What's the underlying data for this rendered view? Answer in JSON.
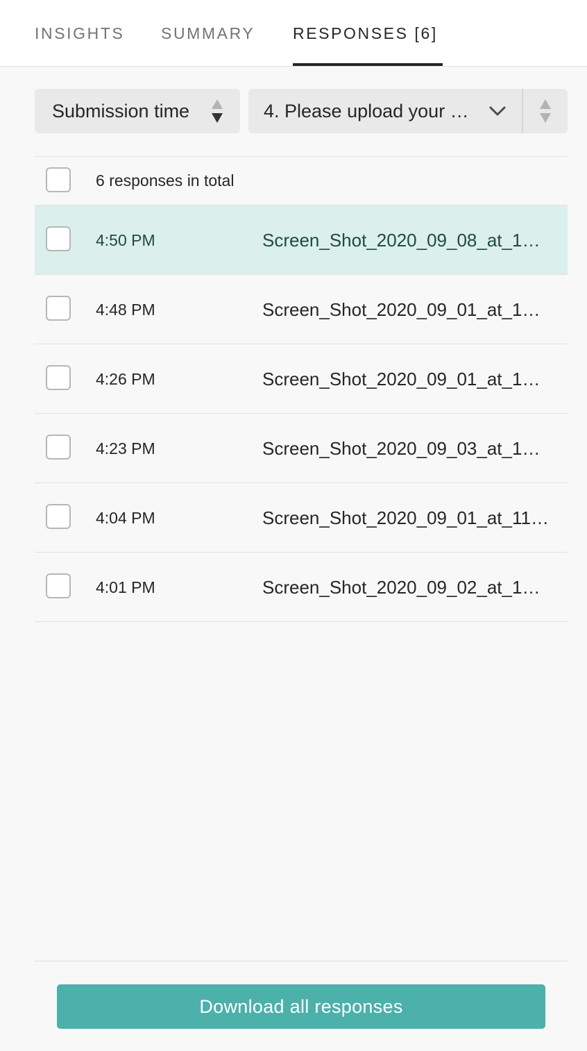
{
  "tabs": [
    {
      "label": "INSIGHTS",
      "active": false
    },
    {
      "label": "SUMMARY",
      "active": false
    },
    {
      "label": "RESPONSES [6]",
      "active": true
    }
  ],
  "filters": {
    "sort_label": "Submission time",
    "question_label": "4. Please upload your …"
  },
  "list": {
    "total_count": "6",
    "total_text": "responses in total",
    "rows": [
      {
        "time": "4:50 PM",
        "file": "Screen_Shot_2020_09_08_at_1…",
        "selected": true
      },
      {
        "time": "4:48 PM",
        "file": "Screen_Shot_2020_09_01_at_1…",
        "selected": false
      },
      {
        "time": "4:26 PM",
        "file": "Screen_Shot_2020_09_01_at_1…",
        "selected": false
      },
      {
        "time": "4:23 PM",
        "file": "Screen_Shot_2020_09_03_at_1…",
        "selected": false
      },
      {
        "time": "4:04 PM",
        "file": "Screen_Shot_2020_09_01_at_11…",
        "selected": false
      },
      {
        "time": "4:01 PM",
        "file": "Screen_Shot_2020_09_02_at_1…",
        "selected": false
      }
    ]
  },
  "footer": {
    "download_label": "Download all responses"
  },
  "colors": {
    "accent": "#4cb0ab",
    "selected_row": "#dbefec",
    "text": "#262627",
    "muted_text": "#737373",
    "page_background": "#f8f8f8"
  },
  "icons": {
    "sort": "sort-arrows-icon",
    "dropdown": "chevron-down-icon"
  }
}
